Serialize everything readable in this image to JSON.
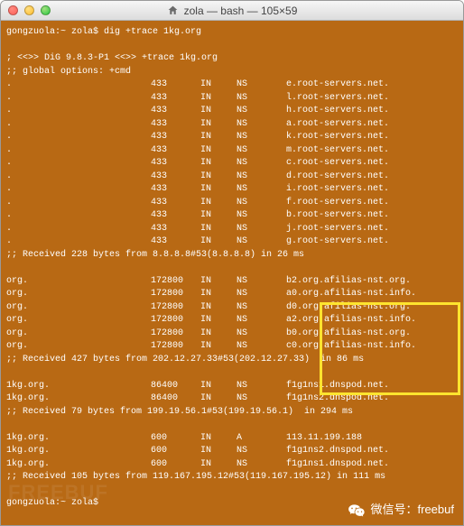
{
  "window": {
    "title": "zola — bash — 105×59"
  },
  "prompt1": {
    "host": "gongzuola:",
    "path": "~ zola$ ",
    "cmd": "dig +trace 1kg.org"
  },
  "header": {
    "line1": "; <<>> DiG 9.8.3-P1 <<>> +trace 1kg.org",
    "line2": ";; global options: +cmd"
  },
  "block1": {
    "dot": ".",
    "rows": [
      {
        "ttl": "433",
        "in": "IN",
        "type": "NS",
        "target": "e.root-servers.net."
      },
      {
        "ttl": "433",
        "in": "IN",
        "type": "NS",
        "target": "l.root-servers.net."
      },
      {
        "ttl": "433",
        "in": "IN",
        "type": "NS",
        "target": "h.root-servers.net."
      },
      {
        "ttl": "433",
        "in": "IN",
        "type": "NS",
        "target": "a.root-servers.net."
      },
      {
        "ttl": "433",
        "in": "IN",
        "type": "NS",
        "target": "k.root-servers.net."
      },
      {
        "ttl": "433",
        "in": "IN",
        "type": "NS",
        "target": "m.root-servers.net."
      },
      {
        "ttl": "433",
        "in": "IN",
        "type": "NS",
        "target": "c.root-servers.net."
      },
      {
        "ttl": "433",
        "in": "IN",
        "type": "NS",
        "target": "d.root-servers.net."
      },
      {
        "ttl": "433",
        "in": "IN",
        "type": "NS",
        "target": "i.root-servers.net."
      },
      {
        "ttl": "433",
        "in": "IN",
        "type": "NS",
        "target": "f.root-servers.net."
      },
      {
        "ttl": "433",
        "in": "IN",
        "type": "NS",
        "target": "b.root-servers.net."
      },
      {
        "ttl": "433",
        "in": "IN",
        "type": "NS",
        "target": "j.root-servers.net."
      },
      {
        "ttl": "433",
        "in": "IN",
        "type": "NS",
        "target": "g.root-servers.net."
      }
    ],
    "footer": ";; Received 228 bytes from 8.8.8.8#53(8.8.8.8) in 26 ms"
  },
  "block2": {
    "domain": "org.",
    "rows": [
      {
        "ttl": "172800",
        "in": "IN",
        "type": "NS",
        "target": "b2.org.afilias-nst.org."
      },
      {
        "ttl": "172800",
        "in": "IN",
        "type": "NS",
        "target": "a0.org.afilias-nst.info."
      },
      {
        "ttl": "172800",
        "in": "IN",
        "type": "NS",
        "target": "d0.org.afilias-nst.org."
      },
      {
        "ttl": "172800",
        "in": "IN",
        "type": "NS",
        "target": "a2.org.afilias-nst.info."
      },
      {
        "ttl": "172800",
        "in": "IN",
        "type": "NS",
        "target": "b0.org.afilias-nst.org."
      },
      {
        "ttl": "172800",
        "in": "IN",
        "type": "NS",
        "target": "c0.org.afilias-nst.info."
      }
    ],
    "footer": ";; Received 427 bytes from 202.12.27.33#53(202.12.27.33)  in 86 ms"
  },
  "block3": {
    "domain": "1kg.org.",
    "rows": [
      {
        "ttl": "86400",
        "in": "IN",
        "type": "NS",
        "target": "f1g1ns1.dnspod.net."
      },
      {
        "ttl": "86400",
        "in": "IN",
        "type": "NS",
        "target": "f1g1ns2.dnspod.net."
      }
    ],
    "footer": ";; Received 79 bytes from 199.19.56.1#53(199.19.56.1)  in 294 ms"
  },
  "block4": {
    "domain": "1kg.org.",
    "rows": [
      {
        "ttl": "600",
        "in": "IN",
        "type": "A",
        "target": "113.11.199.188"
      },
      {
        "ttl": "600",
        "in": "IN",
        "type": "NS",
        "target": "f1g1ns2.dnspod.net."
      },
      {
        "ttl": "600",
        "in": "IN",
        "type": "NS",
        "target": "f1g1ns1.dnspod.net."
      }
    ],
    "footer": ";; Received 105 bytes from 119.167.195.12#53(119.167.195.12) in 111 ms"
  },
  "prompt2": {
    "host": "gongzuola:",
    "path": "~ zola$ "
  },
  "overlay": {
    "wechat_label": "微信号：freebuf",
    "watermark": "FREEBUF"
  }
}
